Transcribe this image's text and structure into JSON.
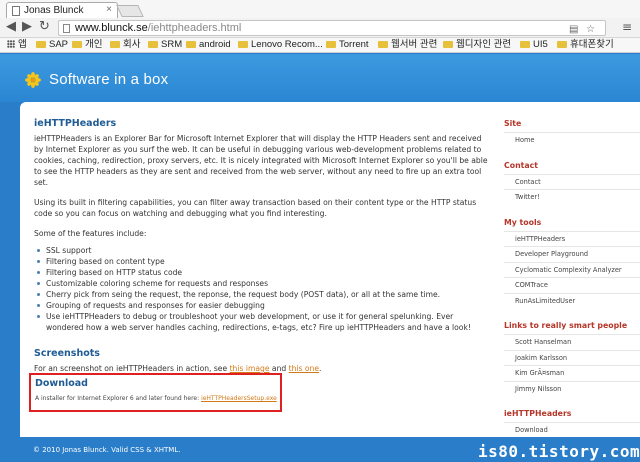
{
  "browser": {
    "tab_title": "Jonas Blunck",
    "tab_close": "×",
    "back": "◀",
    "forward": "▶",
    "reload": "↻",
    "url_domain": "www.blunck.se",
    "url_path": "/iehttpheaders.html",
    "bookmarks": [
      "앱",
      "SAP",
      "개인",
      "회사",
      "SRM",
      "android",
      "Lenovo Recom...",
      "Torrent",
      "웹서버 관련",
      "웹디자인 관련",
      "UI5",
      "휴대폰찾기"
    ]
  },
  "site": {
    "title": "Software in a box"
  },
  "main": {
    "heading": "ieHTTPHeaders",
    "intro": "ieHTTPHeaders is an Explorer Bar for Microsoft Internet Explorer that will display the HTTP Headers sent and received by Internet Explorer as you surf the web. It can be useful in debugging various web-development problems related to cookies, caching, redirection, proxy servers, etc. It is nicely integrated with Microsoft Internet Explorer so you'll be able to see the HTTP headers as they are sent and received from the web server, without any need to fire up an extra tool set.",
    "filtering": "Using its built in filtering capabilities, you can filter away transaction based on their content type or the HTTP status code so you can focus on watching and debugging what you find interesting.",
    "features_intro": "Some of the features include:",
    "features": [
      "SSL support",
      "Filtering based on content type",
      "Filtering based on HTTP status code",
      "Customizable coloring scheme for requests and responses",
      "Cherry pick from seing the request, the reponse, the request body (POST data), or all at the same time.",
      "Grouping of requests and responses for easier debugging",
      "Use ieHTTPHeaders to debug or troubleshoot your web development, or use it for general spelunking. Ever wondered how a web server handles caching, redirections, e-tags, etc? Fire up ieHTTPHeaders and have a look!"
    ],
    "screenshots_heading": "Screenshots",
    "screenshots_text_before": "For an screenshot on ieHTTPHeaders in action, see ",
    "screenshots_link1": "this image",
    "screenshots_and": " and ",
    "screenshots_link2": "this one",
    "screenshots_end": ".",
    "download_heading": "Download",
    "download_text": "A installer for Internet Explorer 6 and later found here: ",
    "download_link": "ieHTTPHeadersSetup.exe"
  },
  "sidebar": {
    "site_title": "Site",
    "site_items": [
      "Home"
    ],
    "contact_title": "Contact",
    "contact_items": [
      "Contact",
      "Twitter!"
    ],
    "tools_title": "My tools",
    "tools_items": [
      "ieHTTPHeaders",
      "Developer Playground",
      "Cyclomatic Complexity Analyzer",
      "COMTrace",
      "RunAsLimitedUser"
    ],
    "links_title": "Links to really smart people",
    "links_items": [
      "Scott Hanselman",
      "Joakim Karlsson",
      "Kim GrÃ¤sman",
      "Jimmy Nilsson"
    ],
    "iehttp_title": "ieHTTPHeaders",
    "iehttp_items": [
      "Download"
    ]
  },
  "footer": {
    "text": "© 2010 Jonas Blunck. Valid CSS & XHTML."
  },
  "watermark": "is80.tistory.com",
  "colors": {
    "brand_blue": "#2a7ec9",
    "heading_blue": "#1f5b94",
    "sidebar_red": "#b6362a",
    "link_orange": "#d27a19",
    "highlight_red": "#e02020"
  }
}
